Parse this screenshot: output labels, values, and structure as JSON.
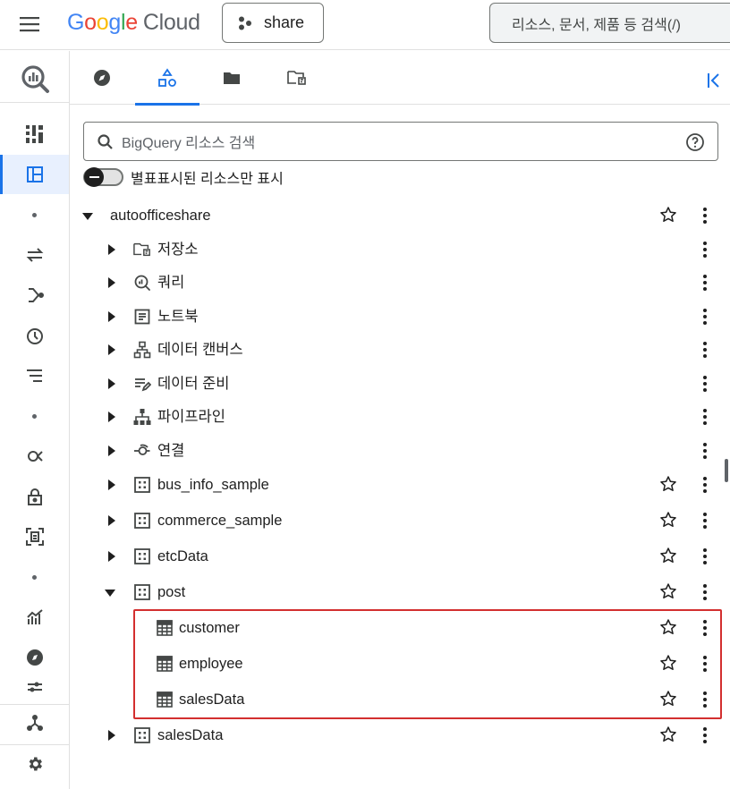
{
  "topbar": {
    "logo": {
      "g1": "G",
      "g2": "o",
      "g3": "o",
      "g4": "g",
      "g5": "l",
      "g6": "e",
      "cloud": "Cloud"
    },
    "project_label": "share",
    "search_placeholder": "리소스, 문서, 제품 등 검색(/)"
  },
  "explorer": {
    "search_placeholder": "BigQuery 리소스 검색",
    "toggle_label": "별표표시된 리소스만 표시"
  },
  "tree": {
    "project": "autoofficeshare",
    "nodes": [
      {
        "label": "저장소",
        "icon": "repository-icon"
      },
      {
        "label": "쿼리",
        "icon": "query-icon"
      },
      {
        "label": "노트북",
        "icon": "notebook-icon"
      },
      {
        "label": "데이터 캔버스",
        "icon": "data-canvas-icon"
      },
      {
        "label": "데이터 준비",
        "icon": "data-prep-icon"
      },
      {
        "label": "파이프라인",
        "icon": "pipeline-icon"
      },
      {
        "label": "연결",
        "icon": "connection-icon"
      }
    ],
    "datasets": [
      {
        "label": "bus_info_sample"
      },
      {
        "label": "commerce_sample"
      },
      {
        "label": "etcData"
      },
      {
        "label": "post",
        "tables": [
          "customer",
          "employee",
          "salesData"
        ]
      },
      {
        "label": "salesData"
      }
    ]
  },
  "colors": {
    "accent": "#1a73e8",
    "highlight": "#d32f2f"
  }
}
